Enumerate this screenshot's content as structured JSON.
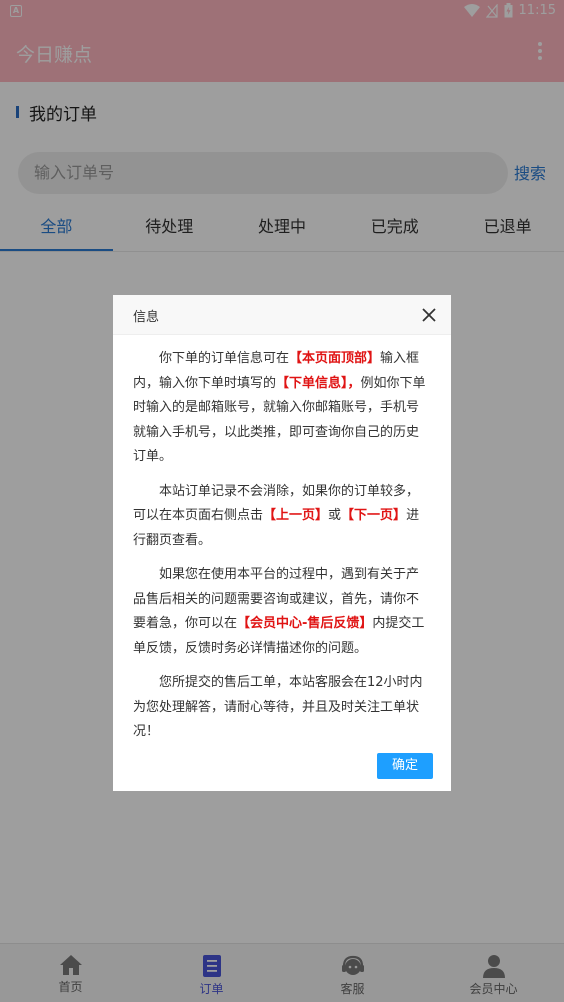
{
  "status_bar": {
    "time": "11:15",
    "app_icon_letter": "A"
  },
  "app_bar": {
    "title": "今日赚点"
  },
  "section": {
    "title": "我的订单"
  },
  "search": {
    "placeholder": "输入订单号",
    "button_label": "搜索"
  },
  "tabs": [
    {
      "label": "全部",
      "active": true
    },
    {
      "label": "待处理"
    },
    {
      "label": "处理中"
    },
    {
      "label": "已完成"
    },
    {
      "label": "已退单"
    }
  ],
  "dialog": {
    "title": "信息",
    "ok_label": "确定",
    "p1": {
      "a": "你下单的订单信息可在",
      "h1": "【本页面顶部】",
      "b": "输入框内，输入你下单时填写的",
      "h2": "【下单信息】，",
      "c": "例如你下单时输入的是邮箱账号，就输入你邮箱账号，手机号就输入手机号，以此类推，即可查询你自己的历史订单。"
    },
    "p2": {
      "a": "本站订单记录不会消除，如果你的订单较多，可以在本页面右侧点击",
      "h1": "【上一页】",
      "b": "或",
      "h2": "【下一页】",
      "c": "进行翻页查看。"
    },
    "p3": {
      "a": "如果您在使用本平台的过程中，遇到有关于产品售后相关的问题需要咨询或建议，首先，请你不要着急，你可以在",
      "h1": "【会员中心-售后反馈】",
      "b": "内提交工单反馈，反馈时务必详情描述你的问题。"
    },
    "p4": {
      "a": "您所提交的售后工单，本站客服会在12小时内为您处理解答，请耐心等待，并且及时关注工单状况！"
    }
  },
  "bottom_nav": [
    {
      "label": "首页",
      "icon": "home-icon"
    },
    {
      "label": "订单",
      "icon": "order-icon",
      "active": true
    },
    {
      "label": "客服",
      "icon": "headset-icon"
    },
    {
      "label": "会员中心",
      "icon": "user-icon"
    }
  ],
  "colors": {
    "app_bar": "#ffb6c1",
    "accent": "#2b7bd4",
    "highlight": "#e01414",
    "ok_button": "#1e9fff"
  }
}
